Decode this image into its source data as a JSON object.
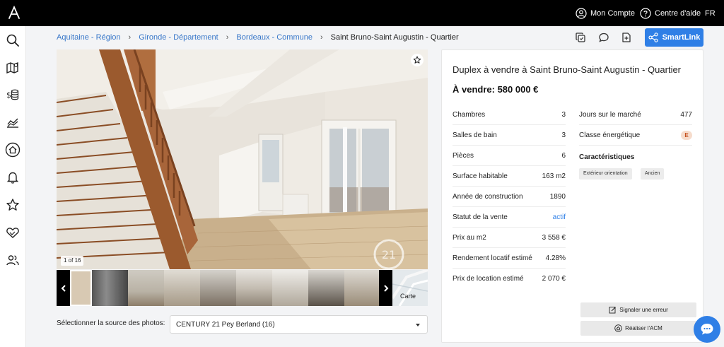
{
  "topbar": {
    "account_label": "Mon Compte",
    "help_label": "Centre d'aide",
    "language": "FR"
  },
  "sidebar": {
    "items": [
      {
        "icon": "search-icon"
      },
      {
        "icon": "map-pin-icon"
      },
      {
        "icon": "finance-coins-icon"
      },
      {
        "icon": "market-chart-icon"
      },
      {
        "icon": "home-search-icon"
      },
      {
        "icon": "bell-icon"
      },
      {
        "icon": "star-icon"
      },
      {
        "icon": "handshake-heart-icon"
      },
      {
        "icon": "users-icon"
      }
    ]
  },
  "breadcrumb": {
    "items": [
      "Aquitaine - Région",
      "Gironde - Département",
      "Bordeaux - Commune",
      "Saint Bruno-Saint Augustin - Quartier"
    ],
    "separator": "›"
  },
  "actions": {
    "smartlink_label": "SmartLink"
  },
  "gallery": {
    "counter": "1 of 16",
    "map_label": "Carte",
    "source_label": "Sélectionner la source des photos:",
    "source_value": "CENTURY 21 Pey Berland (16)"
  },
  "listing": {
    "title": "Duplex à vendre à Saint Bruno-Saint Augustin - Quartier",
    "price": "À vendre: 580 000 €",
    "left_features": [
      {
        "label": "Chambres",
        "value": "3"
      },
      {
        "label": "Salles de bain",
        "value": "3"
      },
      {
        "label": "Pièces",
        "value": "6"
      },
      {
        "label": "Surface habitable",
        "value": "163 m2"
      },
      {
        "label": "Année de construction",
        "value": "1890"
      },
      {
        "label": "Statut de la vente",
        "value": "actif"
      },
      {
        "label": "Prix au m2",
        "value": "3 558 €"
      },
      {
        "label": "Rendement locatif estimé",
        "value": "4.28%"
      },
      {
        "label": "Prix de location estimé",
        "value": "2 070 €"
      }
    ],
    "right_features": [
      {
        "label": "Jours sur le marché",
        "value": "477"
      },
      {
        "label": "Classe énergétique",
        "value": "E"
      }
    ],
    "characteristics_title": "Caractéristiques",
    "tags": [
      "Extérieur orientation",
      "Ancien"
    ],
    "report_error_label": "Signaler une erreur",
    "acm_label": "Réaliser l'ACM"
  },
  "colors": {
    "accent": "#2f7fe6",
    "energy_badge_bg": "#f6dccc",
    "energy_badge_text": "#c5501e"
  }
}
